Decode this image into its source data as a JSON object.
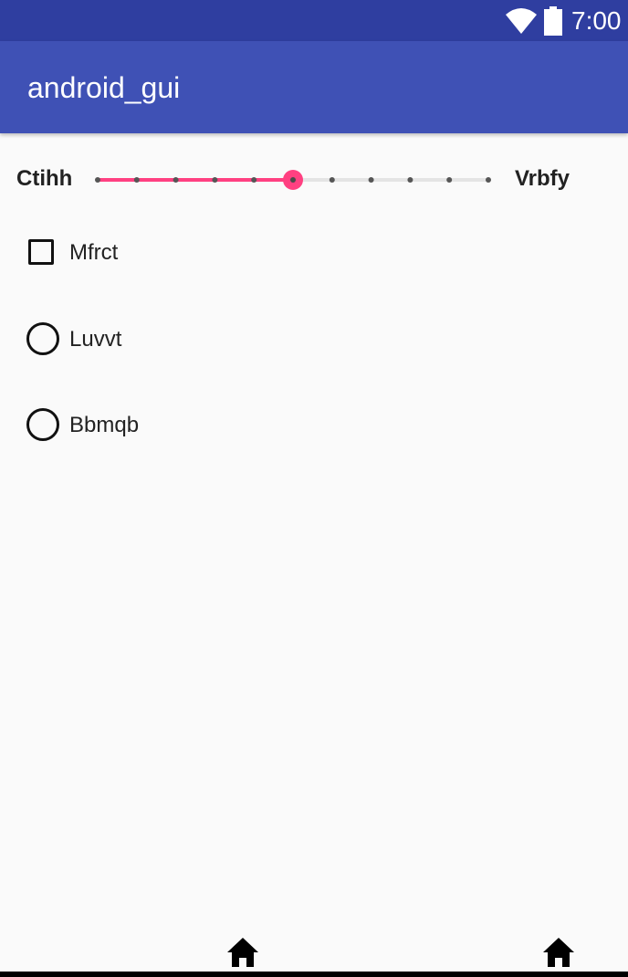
{
  "status_bar": {
    "time": "7:00",
    "icons": [
      "wifi-icon",
      "battery-icon"
    ],
    "background": "#2f3ea0"
  },
  "app_bar": {
    "title": "android_gui",
    "background": "#3f51b5"
  },
  "slider": {
    "left_label": "Ctihh",
    "right_label": "Vrbfy",
    "value": 5,
    "min": 0,
    "max": 10,
    "steps": 10,
    "accent": "#ff4081"
  },
  "checkbox": {
    "label": "Mfrct",
    "checked": false
  },
  "radios": [
    {
      "label": "Luvvt",
      "checked": false
    },
    {
      "label": "Bbmqb",
      "checked": false
    }
  ],
  "bottom_icons": [
    "home-icon",
    "home-icon"
  ]
}
